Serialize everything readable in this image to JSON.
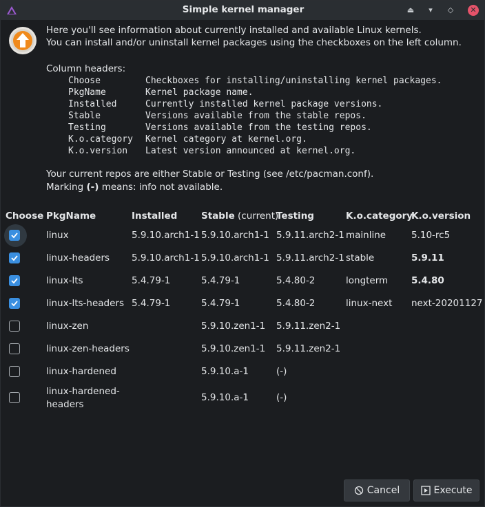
{
  "window": {
    "title": "Simple kernel manager"
  },
  "intro": {
    "line1": "Here you'll see information about currently installed and available Linux kernels.",
    "line2": "You can install and/or uninstall kernel packages using the checkboxes on the left column."
  },
  "column_help": {
    "heading": "Column headers:",
    "items": [
      {
        "name": "Choose",
        "desc": "Checkboxes for installing/uninstalling kernel packages."
      },
      {
        "name": "PkgName",
        "desc": "Kernel package name."
      },
      {
        "name": "Installed",
        "desc": "Currently installed kernel package versions."
      },
      {
        "name": "Stable",
        "desc": "Versions available from the stable repos."
      },
      {
        "name": "Testing",
        "desc": "Versions available from the testing repos."
      },
      {
        "name": "K.o.category",
        "desc": "Kernel category at kernel.org."
      },
      {
        "name": "K.o.version",
        "desc": "Latest version announced at kernel.org."
      }
    ]
  },
  "notes": {
    "line1": "Your current repos are either Stable or Testing (see /etc/pacman.conf).",
    "line2_pre": "Marking ",
    "line2_bold": "(-)",
    "line2_post": " means: info not available."
  },
  "table": {
    "headers": {
      "choose": "Choose",
      "pkgname": "PkgName",
      "installed": "Installed",
      "stable": "Stable",
      "stable_sub": " (current)",
      "testing": "Testing",
      "kocategory": "K.o.category",
      "koversion": "K.o.version"
    },
    "rows": [
      {
        "checked": true,
        "pkg": "linux",
        "installed": "5.9.10.arch1-1",
        "stable": "5.9.10.arch1-1",
        "testing": "5.9.11.arch2-1",
        "kocat": "mainline",
        "kover": "5.10-rc5"
      },
      {
        "checked": true,
        "pkg": "linux-headers",
        "installed": "5.9.10.arch1-1",
        "stable": "5.9.10.arch1-1",
        "testing": "5.9.11.arch2-1",
        "kocat": "stable",
        "kover": "5.9.11"
      },
      {
        "checked": true,
        "pkg": "linux-lts",
        "installed": "5.4.79-1",
        "stable": "5.4.79-1",
        "testing": "5.4.80-2",
        "kocat": "longterm",
        "kover": "5.4.80"
      },
      {
        "checked": true,
        "pkg": "linux-lts-headers",
        "installed": "5.4.79-1",
        "stable": "5.4.79-1",
        "testing": "5.4.80-2",
        "kocat": "linux-next",
        "kover": "next-20201127"
      },
      {
        "checked": false,
        "pkg": "linux-zen",
        "installed": "",
        "stable": "5.9.10.zen1-1",
        "testing": "5.9.11.zen2-1",
        "kocat": "",
        "kover": ""
      },
      {
        "checked": false,
        "pkg": "linux-zen-headers",
        "installed": "",
        "stable": "5.9.10.zen1-1",
        "testing": "5.9.11.zen2-1",
        "kocat": "",
        "kover": ""
      },
      {
        "checked": false,
        "pkg": "linux-hardened",
        "installed": "",
        "stable": "5.9.10.a-1",
        "testing": "(-)",
        "kocat": "",
        "kover": ""
      },
      {
        "checked": false,
        "pkg_line1": "linux-hardened-",
        "pkg_line2": "headers",
        "installed": "",
        "stable": "5.9.10.a-1",
        "testing": "(-)",
        "kocat": "",
        "kover": ""
      }
    ]
  },
  "buttons": {
    "cancel": "Cancel",
    "execute": "Execute"
  },
  "colors": {
    "accent": "#3a8fe0",
    "close": "#e5536a",
    "titlebar": "#2a2e32",
    "background": "#1b1d20"
  }
}
